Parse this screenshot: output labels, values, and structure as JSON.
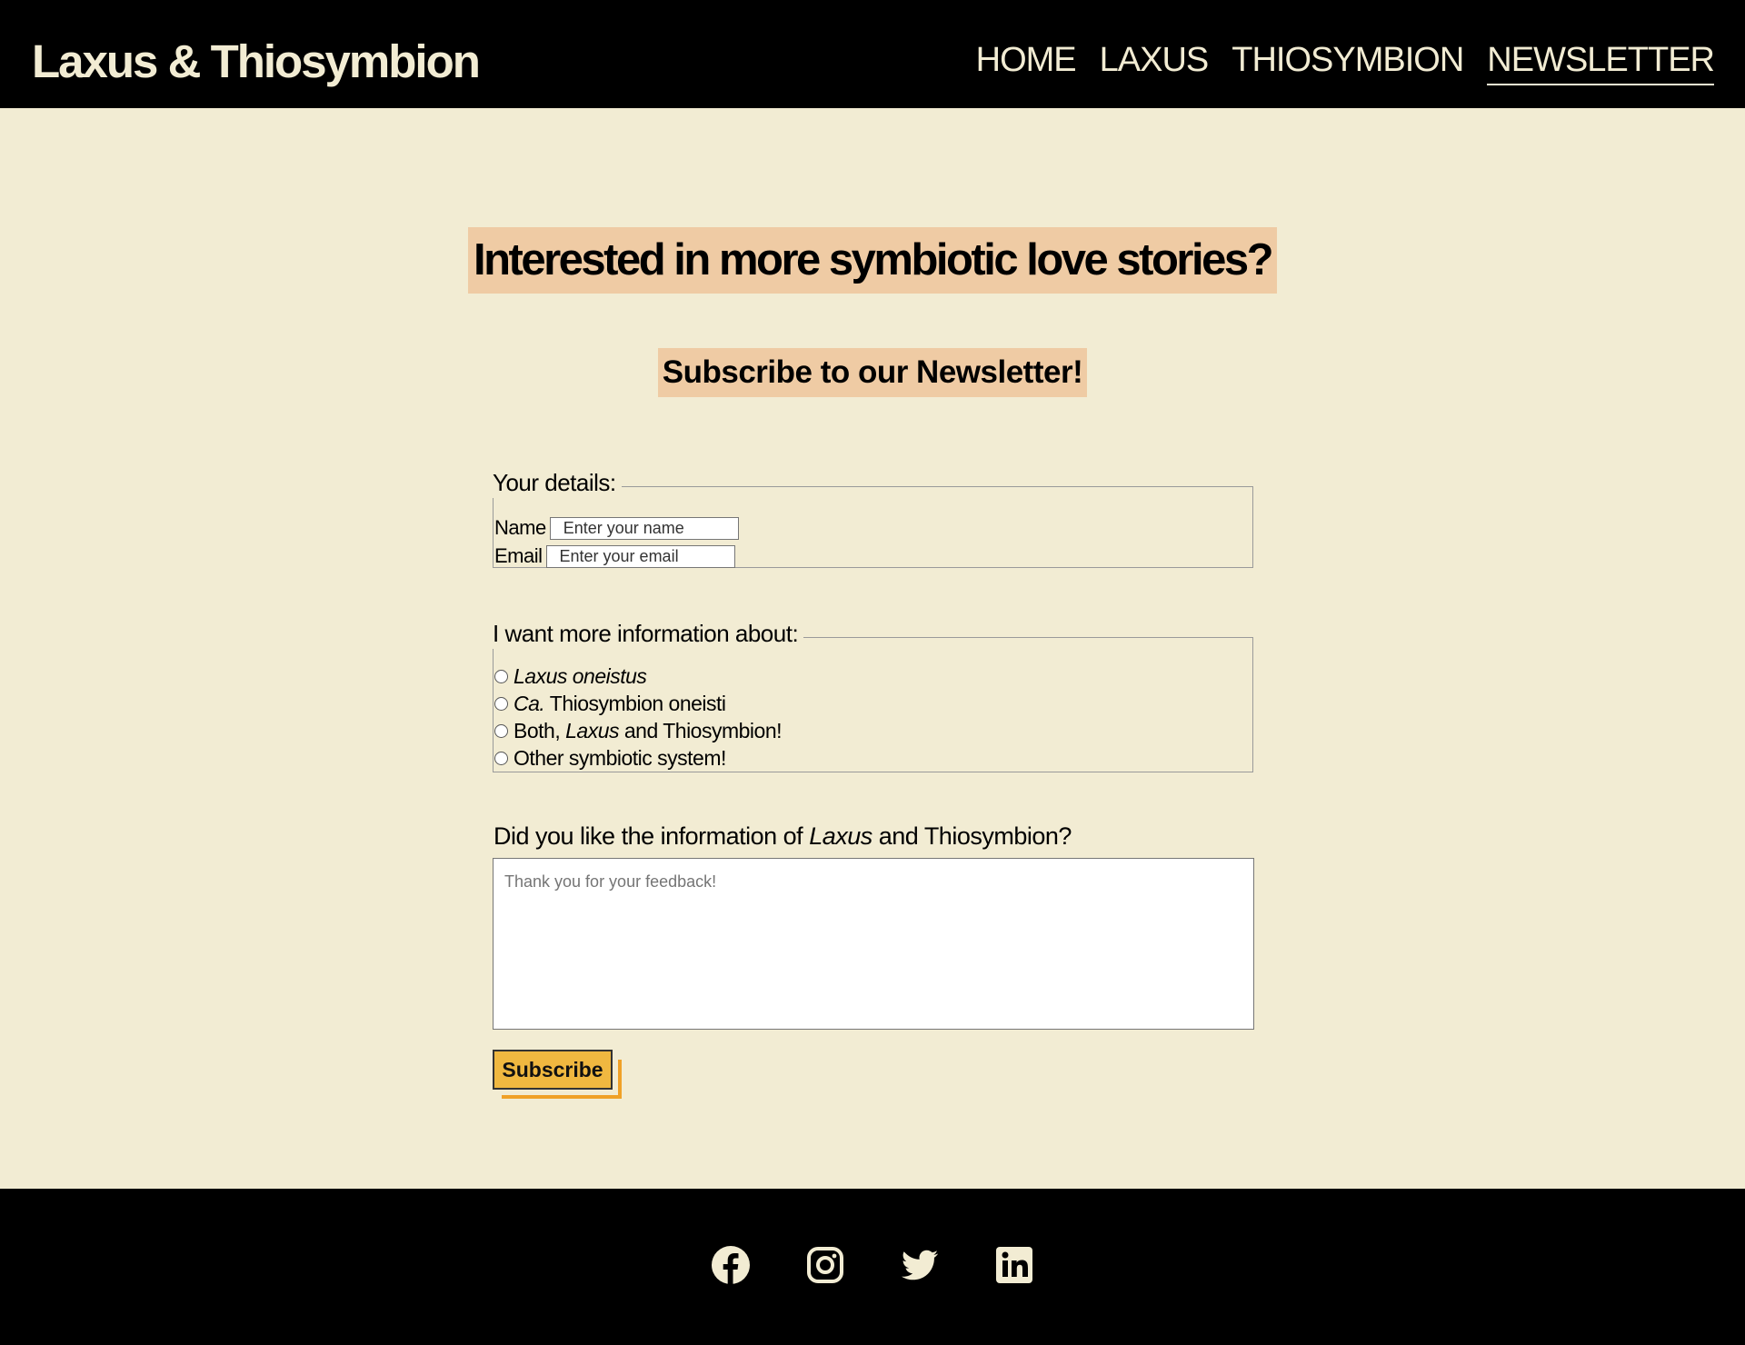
{
  "header": {
    "logo": "Laxus & Thiosymbion",
    "nav": [
      {
        "label": "HOME"
      },
      {
        "label": "LAXUS"
      },
      {
        "label": "THIOSYMBION"
      },
      {
        "label": "NEWSLETTER",
        "active": true
      }
    ]
  },
  "main": {
    "heading": "Interested in more symbiotic love stories?",
    "subheading": "Subscribe to our Newsletter!",
    "details": {
      "legend": "Your details:",
      "name_label": "Name",
      "name_placeholder": "Enter your name",
      "email_label": "Email",
      "email_placeholder": "Enter your email"
    },
    "info": {
      "legend": "I want more information about:",
      "options": [
        {
          "italic": "Laxus oneistus",
          "rest": ""
        },
        {
          "italic": "Ca.",
          "rest": " Thiosymbion oneisti"
        },
        {
          "pre": "Both, ",
          "italic": "Laxus",
          "rest": " and Thiosymbion!"
        },
        {
          "pre": "Other symbiotic system!",
          "italic": "",
          "rest": ""
        }
      ]
    },
    "question": {
      "pre": "Did you like the information of ",
      "italic": "Laxus",
      "rest": " and Thiosymbion?"
    },
    "feedback_placeholder": "Thank you for your feedback!",
    "subscribe_label": "Subscribe"
  },
  "footer": {
    "icons": [
      "facebook-icon",
      "instagram-icon",
      "twitter-icon",
      "linkedin-icon"
    ]
  },
  "colors": {
    "background": "#f2ecd3",
    "header_bg": "#000000",
    "heading_bg": "#efcba4",
    "button": "#f0b840",
    "button_shadow": "#f0a127"
  }
}
